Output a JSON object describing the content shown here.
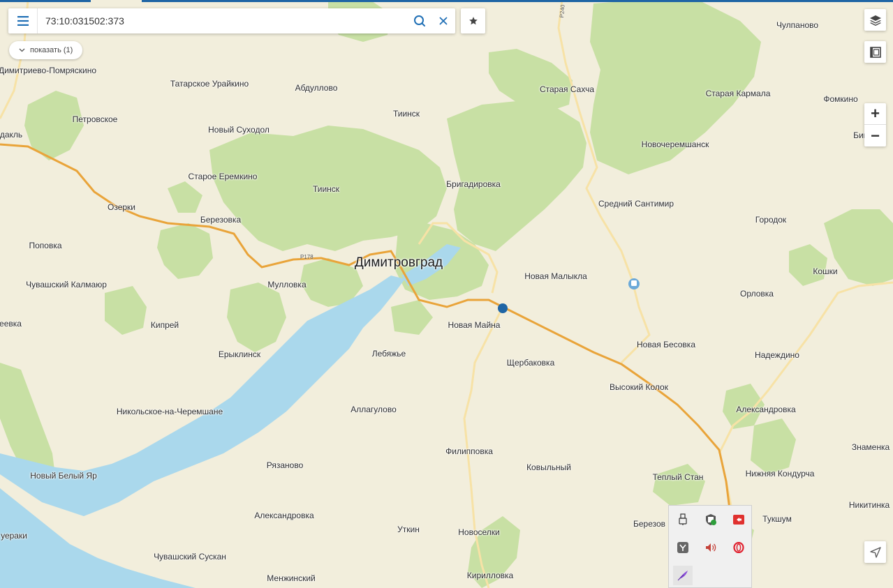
{
  "search": {
    "value": "73:10:031502:373"
  },
  "show_button": {
    "label": "показать (1)"
  },
  "zoom": {
    "plus": "+",
    "minus": "−"
  },
  "road_labels": [
    {
      "text": "P178"
    },
    {
      "text": "P240"
    }
  ],
  "places": [
    {
      "name": "Димитриево-Помряскино"
    },
    {
      "name": "Татарское Урайкино"
    },
    {
      "name": "Абдуллово"
    },
    {
      "name": "Тиинск"
    },
    {
      "name": "Старая Сахча"
    },
    {
      "name": "Старая Кармала"
    },
    {
      "name": "Чулпаново"
    },
    {
      "name": "Фомкино"
    },
    {
      "name": "Петровское"
    },
    {
      "name": "Новый Суходол"
    },
    {
      "name": "дакль"
    },
    {
      "name": "Новочеремшанск"
    },
    {
      "name": "Бик"
    },
    {
      "name": "Старое Еремкино"
    },
    {
      "name": "Тиинск"
    },
    {
      "name": "Бригадировка"
    },
    {
      "name": "Средний Сантимир"
    },
    {
      "name": "Озерки"
    },
    {
      "name": "Березовка"
    },
    {
      "name": "Городок"
    },
    {
      "name": "Поповка"
    },
    {
      "name": "Димитровград"
    },
    {
      "name": "Новая Малыкла"
    },
    {
      "name": "Кошки"
    },
    {
      "name": "Чувашский Калмаюр"
    },
    {
      "name": "Мулловка"
    },
    {
      "name": "Орловка"
    },
    {
      "name": "еевка"
    },
    {
      "name": "Кипрей"
    },
    {
      "name": "Новая Майна"
    },
    {
      "name": "Новая Бесовка"
    },
    {
      "name": "Ерыклинск"
    },
    {
      "name": "Лебяжье"
    },
    {
      "name": "Щербаковка"
    },
    {
      "name": "Надеждино"
    },
    {
      "name": "Высокий Колок"
    },
    {
      "name": "Никольское-на-Черемшане"
    },
    {
      "name": "Аллагулово"
    },
    {
      "name": "Александровка"
    },
    {
      "name": "Знаменка"
    },
    {
      "name": "Филипповка"
    },
    {
      "name": "Рязаново"
    },
    {
      "name": "Ковыльный"
    },
    {
      "name": "Новый Белый Яр"
    },
    {
      "name": "Теплый Стан"
    },
    {
      "name": "Нижняя Кондурча"
    },
    {
      "name": "Никитинка"
    },
    {
      "name": "Александровка"
    },
    {
      "name": "Березов"
    },
    {
      "name": "Тукшум"
    },
    {
      "name": "Уткин"
    },
    {
      "name": "Новоселки"
    },
    {
      "name": "уераки"
    },
    {
      "name": "Чувашский Сускан"
    },
    {
      "name": "Менжинский"
    },
    {
      "name": "Кирилловка"
    }
  ],
  "colors": {
    "land": "#f2eedc",
    "forest": "#c8e0a4",
    "water": "#aad8ec",
    "road_major": "#e9a43a",
    "road_minor": "#f7e2a6",
    "marker": "#1f65a5",
    "top_accent": "#1f65a5",
    "icon": "#1f6fb5"
  },
  "icons": {
    "menu": "menu-icon",
    "search": "search-icon",
    "clear": "close-icon",
    "favorite": "star-icon",
    "layers": "layers-icon",
    "film": "film-icon",
    "locate": "locate-arrow-icon",
    "bus_stop": "bus-stop-icon",
    "marker": "location-marker-icon",
    "tray": [
      "usb-icon",
      "shield-icon",
      "screen-share-icon",
      "yandex-icon",
      "volume-icon",
      "opera-icon",
      "feather-icon"
    ]
  }
}
